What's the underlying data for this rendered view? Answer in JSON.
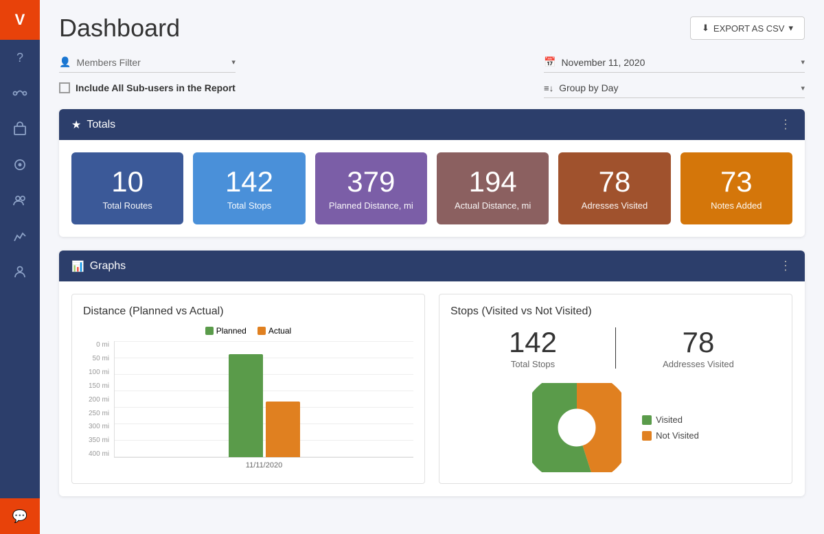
{
  "sidebar": {
    "logo": "V",
    "icons": [
      {
        "name": "help-icon",
        "symbol": "?"
      },
      {
        "name": "routes-icon",
        "symbol": "⤴"
      },
      {
        "name": "cart-icon",
        "symbol": "🛒"
      },
      {
        "name": "dispatch-icon",
        "symbol": "⚙"
      },
      {
        "name": "team-icon",
        "symbol": "👥"
      },
      {
        "name": "analytics-icon",
        "symbol": "📈"
      },
      {
        "name": "users-icon",
        "symbol": "👤"
      }
    ],
    "chat_symbol": "💬"
  },
  "header": {
    "title": "Dashboard",
    "export_label": "EXPORT AS CSV"
  },
  "filters": {
    "members_placeholder": "Members Filter",
    "date_value": "November 11, 2020",
    "include_subusers_label": "Include All Sub-users in the Report",
    "group_by_label": "Group by Day"
  },
  "totals": {
    "section_title": "Totals",
    "cards": [
      {
        "number": "10",
        "label": "Total Routes",
        "color_class": "card-blue-dark"
      },
      {
        "number": "142",
        "label": "Total Stops",
        "color_class": "card-blue-medium"
      },
      {
        "number": "379",
        "label": "Planned Distance, mi",
        "color_class": "card-purple"
      },
      {
        "number": "194",
        "label": "Actual Distance, mi",
        "color_class": "card-brown"
      },
      {
        "number": "78",
        "label": "Adresses Visited",
        "color_class": "card-red-brown"
      },
      {
        "number": "73",
        "label": "Notes Added",
        "color_class": "card-orange"
      }
    ]
  },
  "graphs": {
    "section_title": "Graphs",
    "distance_chart": {
      "title": "Distance (Planned vs Actual)",
      "legend_planned": "Planned",
      "legend_actual": "Actual",
      "y_labels": [
        "0 mi",
        "50 mi",
        "100 mi",
        "150 mi",
        "200 mi",
        "250 mi",
        "300 mi",
        "350 mi",
        "400 mi"
      ],
      "planned_height_pct": 92,
      "actual_height_pct": 50,
      "x_label": "11/11/2020"
    },
    "stops_chart": {
      "title": "Stops (Visited vs Not Visited)",
      "total_stops_number": "142",
      "total_stops_label": "Total Stops",
      "addresses_visited_number": "78",
      "addresses_visited_label": "Addresses Visited",
      "legend_visited": "Visited",
      "legend_not_visited": "Not Visited",
      "pie_visited_pct": 55,
      "pie_not_visited_pct": 45
    }
  }
}
